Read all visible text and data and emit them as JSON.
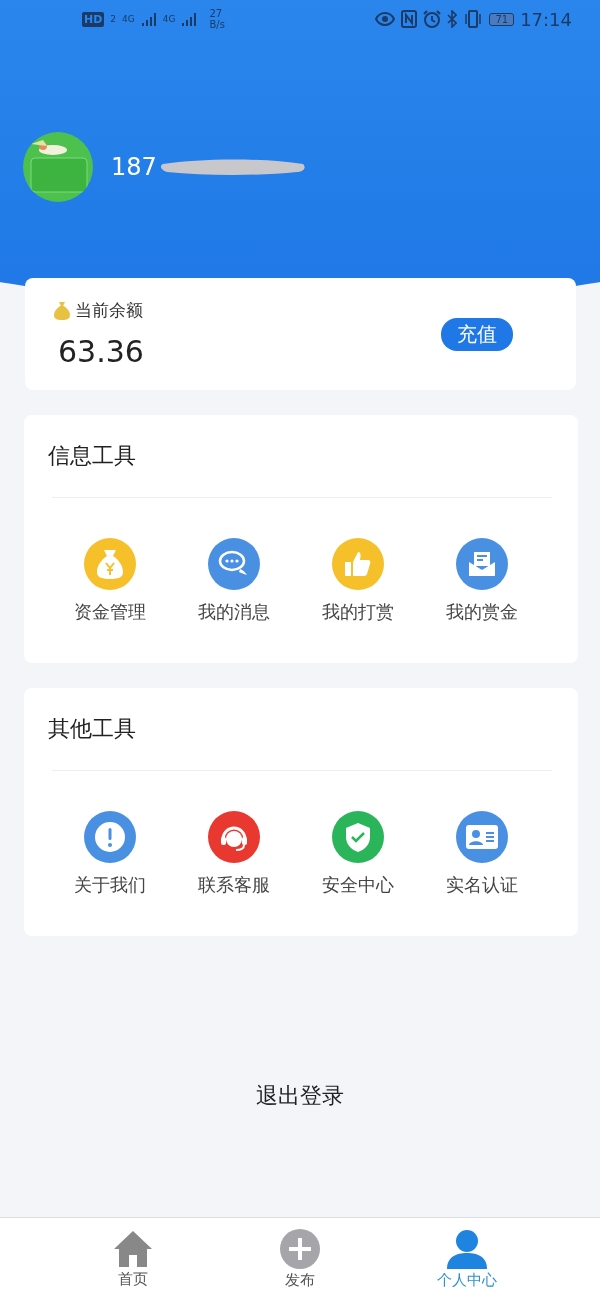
{
  "status_bar": {
    "hd": "HD",
    "sim": "2",
    "network_1": "4G",
    "network_2": "4G",
    "speed_value": "27",
    "speed_unit": "B/s",
    "battery": "71",
    "time": "17:14"
  },
  "profile": {
    "phone_visible": "187"
  },
  "balance": {
    "label": "当前余额",
    "amount": "63.36",
    "recharge_button": "充值"
  },
  "sections": [
    {
      "title": "信息工具",
      "items": [
        {
          "label": "资金管理",
          "kind": "money-bag",
          "color": "#f5c02a"
        },
        {
          "label": "我的消息",
          "kind": "chat",
          "color": "#4a90e2"
        },
        {
          "label": "我的打赏",
          "kind": "thumb",
          "color": "#f5c02a"
        },
        {
          "label": "我的赏金",
          "kind": "mail",
          "color": "#4a90e2"
        }
      ]
    },
    {
      "title": "其他工具",
      "items": [
        {
          "label": "关于我们",
          "kind": "info",
          "color": "#4a90e2"
        },
        {
          "label": "联系客服",
          "kind": "headset",
          "color": "#e8382f"
        },
        {
          "label": "安全中心",
          "kind": "shield",
          "color": "#2bb55a"
        },
        {
          "label": "实名认证",
          "kind": "id-card",
          "color": "#4a90e2"
        }
      ]
    }
  ],
  "logout": "退出登录",
  "tabs": [
    {
      "label": "首页",
      "kind": "home",
      "selected": false
    },
    {
      "label": "发布",
      "kind": "plus",
      "selected": false
    },
    {
      "label": "个人中心",
      "kind": "person",
      "selected": true
    }
  ]
}
